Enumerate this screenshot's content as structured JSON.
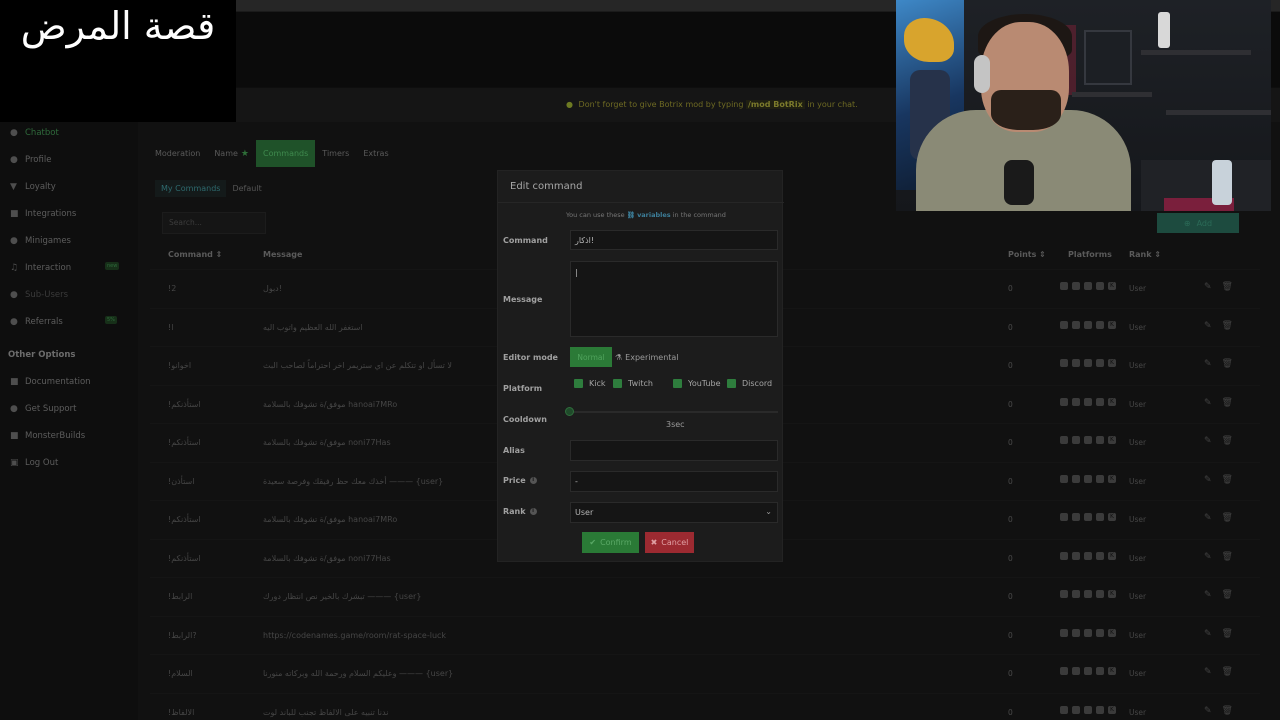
{
  "overlay_title": "قصة المرض",
  "notice": {
    "prefix": "Don't forget to give Botrix mod by typing",
    "code": "/mod BotRix",
    "suffix": "in your chat."
  },
  "sidebar": {
    "items": [
      {
        "label": "Chatbot",
        "icon": "robot-icon"
      },
      {
        "label": "Profile",
        "icon": "user-icon"
      },
      {
        "label": "Loyalty",
        "icon": "trophy-icon"
      },
      {
        "label": "Integrations",
        "icon": "plug-icon"
      },
      {
        "label": "Minigames",
        "icon": "gamepad-icon"
      },
      {
        "label": "Interaction",
        "icon": "music-icon"
      },
      {
        "label": "Sub-Users",
        "icon": "users-icon"
      },
      {
        "label": "Referrals",
        "icon": "people-icon"
      }
    ],
    "other_heading": "Other Options",
    "other_items": [
      {
        "label": "Documentation",
        "icon": "book-icon"
      },
      {
        "label": "Get Support",
        "icon": "support-icon"
      },
      {
        "label": "MonsterBuilds",
        "icon": "box-icon"
      },
      {
        "label": "Log Out",
        "icon": "logout-icon"
      }
    ]
  },
  "tabs": [
    "Moderation",
    "Name",
    "Commands",
    "Timers",
    "Extras"
  ],
  "subtabs": [
    "My Commands",
    "Default"
  ],
  "search_placeholder": "Search...",
  "add_label": "Add",
  "table": {
    "headers": {
      "command": "Command",
      "message": "Message",
      "points": "Points",
      "platforms": "Platforms",
      "rank": "Rank"
    },
    "rows": [
      {
        "command": "!2",
        "message": "دبول!",
        "points": "0",
        "rank": "User"
      },
      {
        "command": "!l",
        "message": "استغفر الله العظيم واتوب اليه",
        "points": "0",
        "rank": "User"
      },
      {
        "command": "!اخوانو",
        "message": "لا تسأل او تتكلم عن اي ستريمر اخر احتراماً لصاحب البث",
        "points": "0",
        "rank": "User"
      },
      {
        "command": "!استأذنكم",
        "message": "موفق/ة تشوفك بالسلامة hanoai7MRo",
        "points": "0",
        "rank": "User"
      },
      {
        "command": "!استأذنكم",
        "message": "موفق/ة تشوفك بالسلامة noni77Has",
        "points": "0",
        "rank": "User"
      },
      {
        "command": "!استأذن",
        "message": "أخذك معك حظ رفيقك وفرصة سعيدة ——— {user}",
        "points": "0",
        "rank": "User"
      },
      {
        "command": "!استأذنكم",
        "message": "موفق/ة تشوفك بالسلامة hanoai7MRo",
        "points": "0",
        "rank": "User"
      },
      {
        "command": "!استأذنكم",
        "message": "موفق/ة تشوفك بالسلامة noni77Has",
        "points": "0",
        "rank": "User"
      },
      {
        "command": "!الرابط",
        "message": "تبشرك بالخير نص انتظار دورك ——— {user}",
        "points": "0",
        "rank": "User"
      },
      {
        "command": "!الرابط?",
        "message": "https://codenames.game/room/rat-space-luck",
        "points": "0",
        "rank": "User"
      },
      {
        "command": "!السلام",
        "message": "وعليكم السلام ورحمة الله وبركاته منورنا ——— {user}",
        "points": "0",
        "rank": "User"
      },
      {
        "command": "!الالفاظ",
        "message": "ندنا تنبيه على الالفاظ تجنب للباند لوت",
        "points": "0",
        "rank": "User"
      }
    ]
  },
  "modal": {
    "title": "Edit command",
    "hint_prefix": "You can use these",
    "hint_link": "variables",
    "hint_suffix": "in the command",
    "labels": {
      "command": "Command",
      "message": "Message",
      "editor_mode": "Editor mode",
      "platform": "Platform",
      "cooldown": "Cooldown",
      "alias": "Alias",
      "price": "Price",
      "rank": "Rank"
    },
    "command_value": "!اذكار",
    "message_value": "|",
    "editor_normal": "Normal",
    "editor_experimental": "Experimental",
    "platforms": [
      "Kick",
      "Twitch",
      "YouTube",
      "Discord"
    ],
    "cooldown_value": "3sec",
    "cooldown_fraction": 0,
    "alias_value": "",
    "price_value": "-",
    "rank_value": "User",
    "confirm_label": "Confirm",
    "cancel_label": "Cancel"
  },
  "colors": {
    "accent_green": "#2b7a37",
    "cancel_red": "#9c2a31",
    "link_blue": "#3c7d98"
  }
}
